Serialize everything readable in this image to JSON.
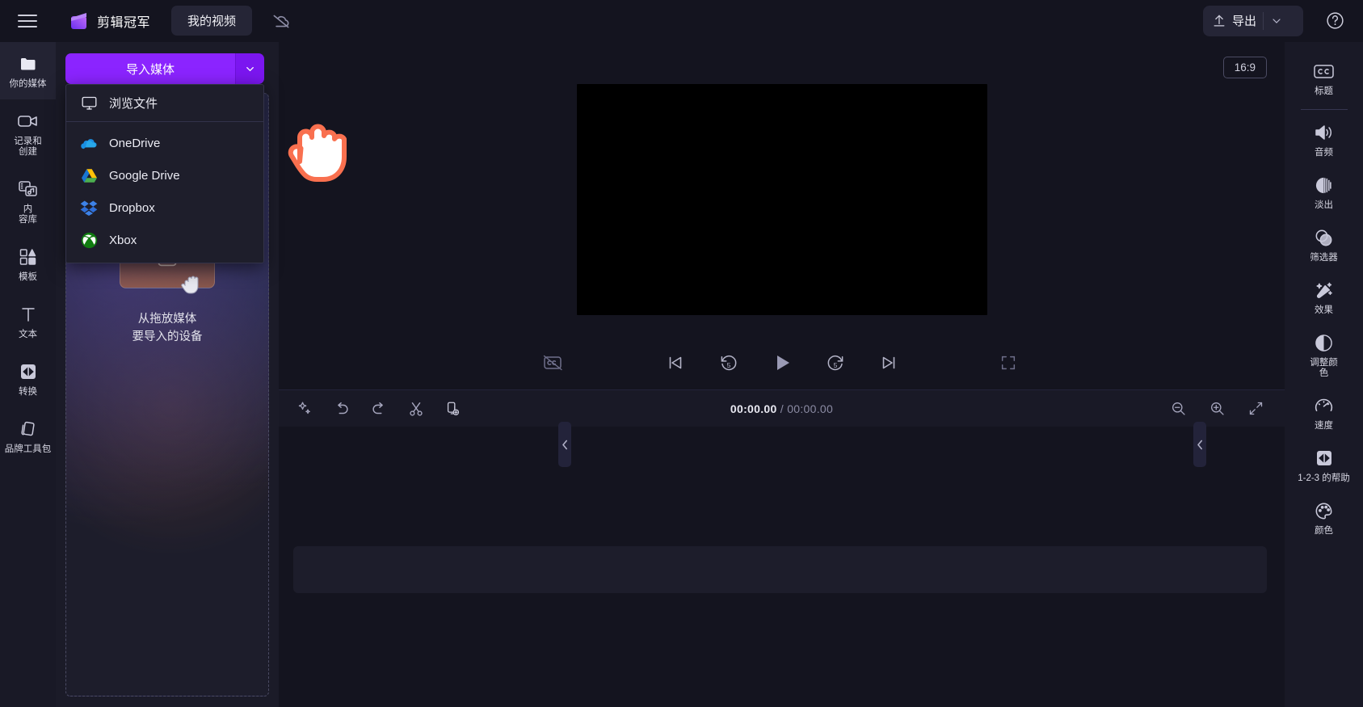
{
  "app": {
    "brand_name": "剪辑冠军",
    "project_tab": "我的视频",
    "menu_icon": "hamburger-icon",
    "cloud_icon": "cloud-off-icon"
  },
  "topbar": {
    "export_label": "导出",
    "export_icon": "upload-icon",
    "export_caret_icon": "chevron-down-icon",
    "help_icon": "question-circle-icon"
  },
  "left_rail": {
    "items": [
      {
        "label": "你的媒体",
        "icon": "folder-icon",
        "active": true
      },
      {
        "label": "记录和\n创建",
        "icon": "video-camera-icon",
        "active": false
      },
      {
        "label": "内\n容库",
        "icon": "content-library-icon",
        "active": false
      },
      {
        "label": "模板",
        "icon": "templates-icon",
        "active": false
      },
      {
        "label": "文本",
        "icon": "text-icon",
        "active": false
      },
      {
        "label": "转换",
        "icon": "transitions-icon",
        "active": false
      },
      {
        "label": "品牌工具包",
        "icon": "brand-kit-icon",
        "active": false
      }
    ]
  },
  "media_panel": {
    "import_label": "导入媒体",
    "import_caret_icon": "chevron-down-icon",
    "dropzone_text": "从拖放媒体\n要导入的设备",
    "dropzone_thumb_icon": "image-placeholder-icon",
    "dropzone_hand_icon": "grab-hand-icon"
  },
  "import_menu": {
    "browse": {
      "label": "浏览文件",
      "icon": "monitor-icon"
    },
    "sources": [
      {
        "label": "OneDrive",
        "icon": "onedrive-icon"
      },
      {
        "label": "Google Drive",
        "icon": "google-drive-icon"
      },
      {
        "label": "Dropbox",
        "icon": "dropbox-icon"
      },
      {
        "label": "Xbox",
        "icon": "xbox-icon"
      }
    ]
  },
  "preview": {
    "ratio_label": "16:9",
    "controls": [
      {
        "name": "captions-off-button",
        "icon": "captions-off-icon"
      },
      {
        "name": "prev-frame-button",
        "icon": "skip-start-icon"
      },
      {
        "name": "back-5s-button",
        "icon": "rewind-5-icon"
      },
      {
        "name": "play-button",
        "icon": "play-icon"
      },
      {
        "name": "forward-5s-button",
        "icon": "forward-5-icon"
      },
      {
        "name": "next-frame-button",
        "icon": "skip-end-icon"
      },
      {
        "name": "fullscreen-button",
        "icon": "fullscreen-icon"
      }
    ]
  },
  "timeline": {
    "tools": [
      {
        "name": "magic-button",
        "icon": "sparkle-icon"
      },
      {
        "name": "undo-button",
        "icon": "undo-icon"
      },
      {
        "name": "redo-button",
        "icon": "redo-icon"
      },
      {
        "name": "split-button",
        "icon": "scissors-icon"
      },
      {
        "name": "duplicate-button",
        "icon": "duplicate-add-icon"
      }
    ],
    "current_time": "00:00.00",
    "separator": "/",
    "total_time": "00:00.00",
    "right_tools": [
      {
        "name": "zoom-out-button",
        "icon": "zoom-out-icon"
      },
      {
        "name": "zoom-in-button",
        "icon": "zoom-in-icon"
      },
      {
        "name": "fit-timeline-button",
        "icon": "fit-icon"
      }
    ]
  },
  "right_rail": {
    "items": [
      {
        "label": "标题",
        "icon": "captions-cc-icon"
      },
      {
        "label": "音频",
        "icon": "speaker-icon"
      },
      {
        "label": "淡出",
        "icon": "fade-icon"
      },
      {
        "label": "筛选器",
        "icon": "filters-icon"
      },
      {
        "label": "效果",
        "icon": "effects-wand-icon"
      },
      {
        "label": "调整颜\n色",
        "icon": "adjust-color-icon"
      },
      {
        "label": "速度",
        "icon": "speed-gauge-icon"
      },
      {
        "label": "1-2-3 的帮助",
        "icon": "transitions-icon"
      },
      {
        "label": "颜色",
        "icon": "palette-icon"
      }
    ]
  },
  "colors": {
    "accent": "#8b24ff",
    "cursor_outline": "#f9704f",
    "panel_bg": "#1b1b28",
    "rail_bg": "#191926",
    "app_bg": "#14141f"
  }
}
